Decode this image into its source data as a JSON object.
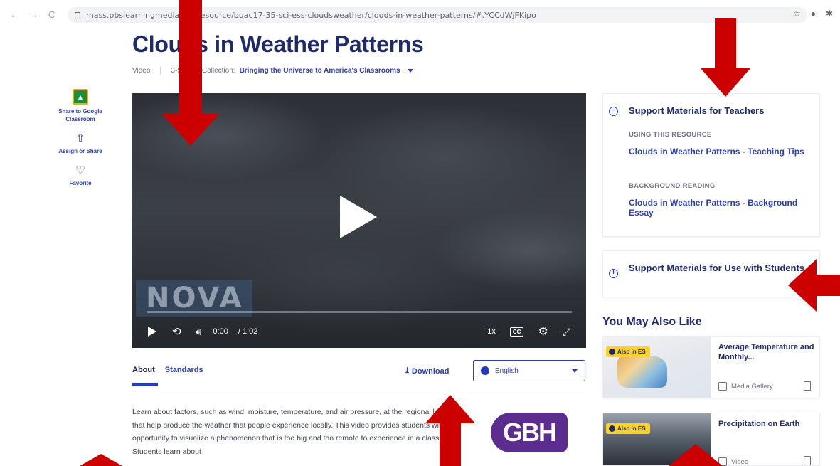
{
  "browser": {
    "url": "mass.pbslearningmedia.org/resource/buac17-35-sci-ess-cloudsweather/clouds-in-weather-patterns/#.YCCdWjFKipo",
    "nav": [
      "←",
      "→",
      "C"
    ],
    "extensions": [
      "☆",
      "●",
      "✱"
    ]
  },
  "page": {
    "title": "Clouds in Weather Patterns",
    "meta": {
      "type": "Video",
      "grades": "3-5",
      "collection_label": "Collection:",
      "collection_value": "Bringing the Universe to America's Classrooms"
    }
  },
  "rail": {
    "classroom": "Share to Google Classroom",
    "assign": "Assign or Share",
    "favorite": "Favorite"
  },
  "video": {
    "watermark": "NOVA",
    "time_current": "0:00",
    "time_duration": "/ 1:02",
    "speed": "1x",
    "cc": "CC"
  },
  "tabs": {
    "about": "About",
    "standards": "Standards",
    "download": "Download",
    "language": "English"
  },
  "description": "Learn about factors, such as wind, moisture, temperature, and air pressure, at the regional level that help produce the weather that people experience locally. This video provides students with the opportunity to visualize a phenomenon that is too big and too remote to experience in a classroom. Students learn about",
  "producer_logo": "GBH",
  "support_teachers": {
    "heading": "Support Materials for Teachers",
    "section1_label": "USING THIS RESOURCE",
    "section1_link": "Clouds in Weather Patterns - Teaching Tips",
    "section2_label": "BACKGROUND READING",
    "section2_link": "Clouds in Weather Patterns - Background Essay"
  },
  "support_students": {
    "heading": "Support Materials for Use with Students"
  },
  "also_like": {
    "heading": "You May Also Like",
    "items": [
      {
        "badge": "Also in ES",
        "title": "Average Temperature and Monthly...",
        "type": "Media Gallery"
      },
      {
        "badge": "Also in ES",
        "title": "Precipitation on Earth",
        "type": "Video"
      }
    ]
  },
  "colors": {
    "brand_blue": "#2a3bb8",
    "title_navy": "#1f2a66",
    "annotation_red": "#cc0000",
    "badge_yellow": "#ffd21f"
  }
}
